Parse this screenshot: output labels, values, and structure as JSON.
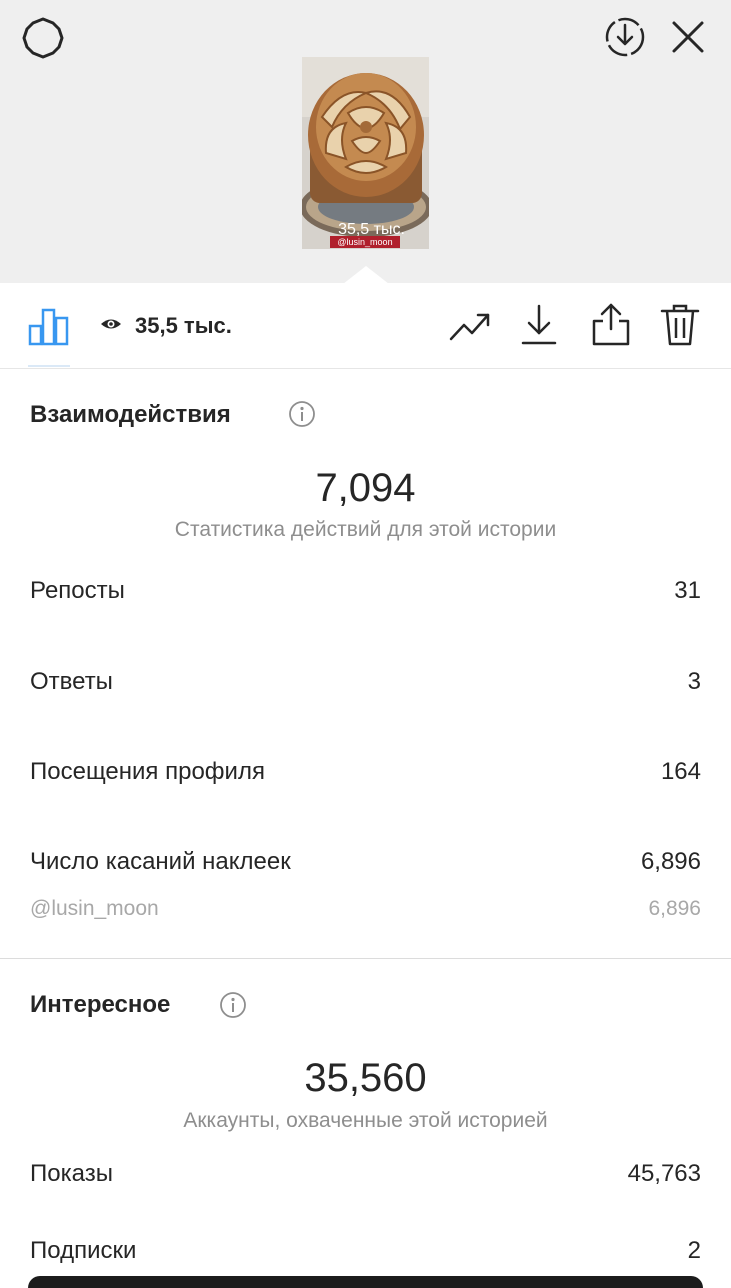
{
  "header": {
    "settings_icon": "gear-icon",
    "download_icon": "circle-download-icon",
    "close_icon": "close-icon"
  },
  "story_preview": {
    "views_overlay": "35,5 тыс.",
    "tag": "@lusin_moon"
  },
  "toolbar": {
    "views": "35,5 тыс.",
    "icons": [
      "bar-chart-icon",
      "eye-icon",
      "trend-icon",
      "download-icon",
      "share-icon",
      "trash-icon"
    ],
    "accent_color": "#3897f0"
  },
  "interactions": {
    "title": "Взаимодействия",
    "total": "7,094",
    "subtitle": "Статистика действий для этой истории",
    "rows": [
      {
        "label": "Репосты",
        "value": "31"
      },
      {
        "label": "Ответы",
        "value": "3"
      },
      {
        "label": "Посещения профиля",
        "value": "164"
      },
      {
        "label": "Число касаний наклеек",
        "value": "6,896"
      }
    ],
    "sticker": {
      "label": "@lusin_moon",
      "value": "6,896"
    }
  },
  "discovery": {
    "title": "Интересное",
    "total": "35,560",
    "subtitle": "Аккаунты, охваченные этой историей",
    "rows": [
      {
        "label": "Показы",
        "value": "45,763"
      },
      {
        "label": "Подписки",
        "value": "2"
      }
    ]
  }
}
